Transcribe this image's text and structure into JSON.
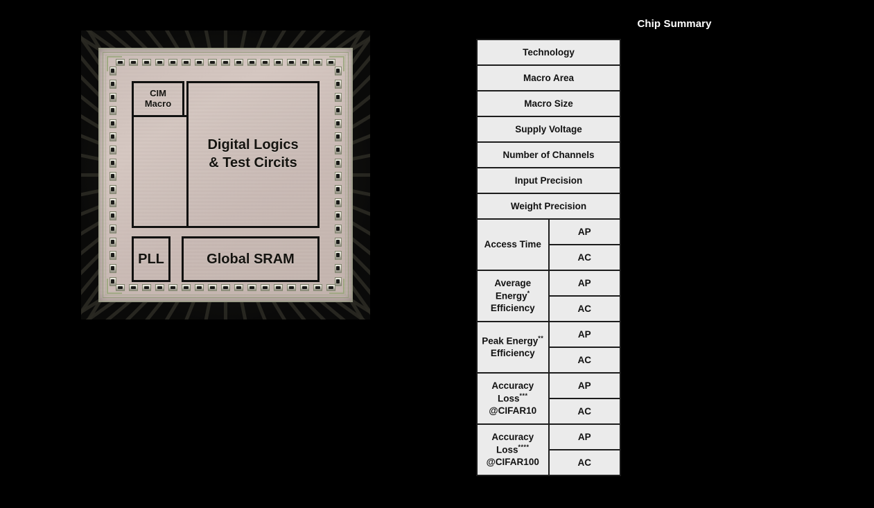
{
  "figure": {
    "summary_title": "Chip Summary"
  },
  "die_photo": {
    "blocks": [
      {
        "name": "cim-macro",
        "label_line1": "CIM",
        "label_line2": "Macro"
      },
      {
        "name": "digital-logics",
        "label_line1": "Digital Logics",
        "label_line2": "& Test Circits"
      },
      {
        "name": "pll",
        "label": "PLL"
      },
      {
        "name": "global-sram",
        "label": "Global SRAM"
      }
    ],
    "cim_macro_label_line1": "CIM",
    "cim_macro_label_line2": "Macro",
    "digital_label_line1": "Digital Logics",
    "digital_label_line2": "& Test Circits",
    "pll_label": "PLL",
    "sram_label": "Global SRAM"
  },
  "summary_table": {
    "simple_rows": [
      {
        "label": "Technology"
      },
      {
        "label": "Macro Area"
      },
      {
        "label": "Macro Size"
      },
      {
        "label": "Supply Voltage"
      },
      {
        "label": "Number of Channels"
      },
      {
        "label": "Input Precision"
      },
      {
        "label": "Weight Precision"
      }
    ],
    "split_rows": [
      {
        "label_line1": "Access Time",
        "label_line2": "",
        "superscript": "",
        "modes": [
          "AP",
          "AC"
        ]
      },
      {
        "label_line1": "Average Energy",
        "label_line2": "Efficiency",
        "superscript": "*",
        "modes": [
          "AP",
          "AC"
        ]
      },
      {
        "label_line1": "Peak Energy",
        "label_line2": "Efficiency",
        "superscript": "**",
        "modes": [
          "AP",
          "AC"
        ]
      },
      {
        "label_line1": "Accuracy Loss",
        "label_line2": "@CIFAR10",
        "superscript": "***",
        "modes": [
          "AP",
          "AC"
        ]
      },
      {
        "label_line1": "Accuracy Loss",
        "label_line2": "@CIFAR100",
        "superscript": "****",
        "modes": [
          "AP",
          "AC"
        ]
      }
    ]
  },
  "colors": {
    "background": "#000000",
    "cell_fill": "#ebebeb",
    "cell_border": "#1c1c1c",
    "title_text": "#ffffff",
    "die_metal": "#d2c3bd"
  }
}
